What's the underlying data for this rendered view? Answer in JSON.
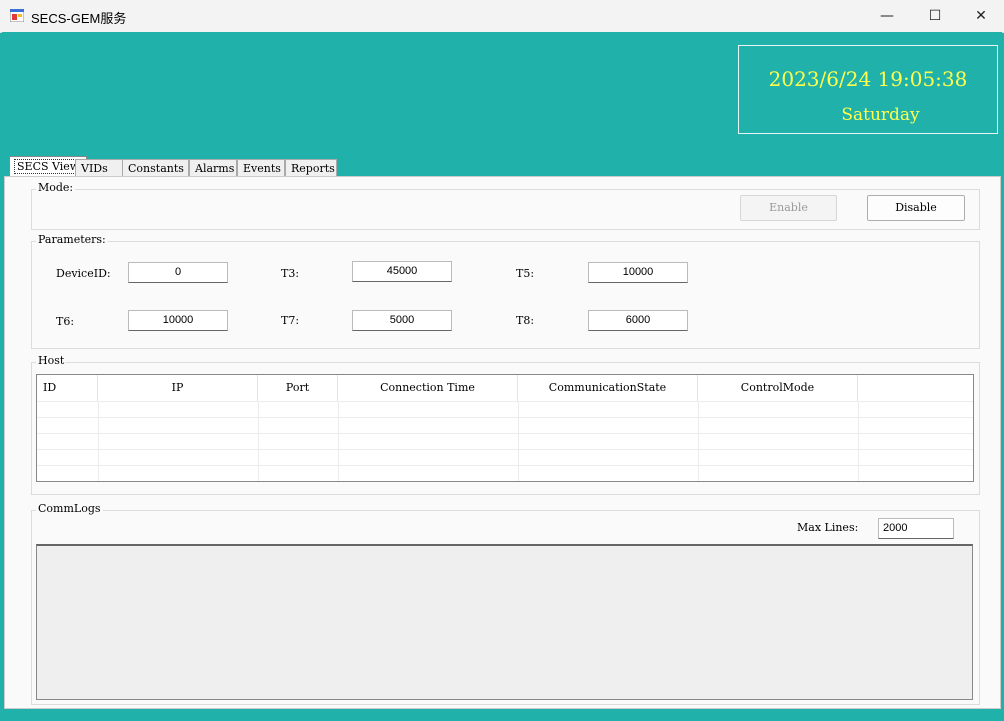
{
  "window": {
    "title": "SECS-GEM服务",
    "minimize": "—",
    "maximize": "☐",
    "close": "✕"
  },
  "clock": {
    "datetime": "2023/6/24 19:05:38",
    "weekday": "Saturday"
  },
  "tabs": [
    "SECS View",
    "VIDs",
    "Constants",
    "Alarms",
    "Events",
    "Reports"
  ],
  "mode": {
    "legend": "Mode:",
    "enable_label": "Enable",
    "disable_label": "Disable"
  },
  "parameters": {
    "legend": "Parameters:",
    "device_id": {
      "label": "DeviceID:",
      "value": "0"
    },
    "t3": {
      "label": "T3:",
      "value": "45000"
    },
    "t5": {
      "label": "T5:",
      "value": "10000"
    },
    "t6": {
      "label": "T6:",
      "value": "10000"
    },
    "t7": {
      "label": "T7:",
      "value": "5000"
    },
    "t8": {
      "label": "T8:",
      "value": "6000"
    }
  },
  "host": {
    "legend": "Host",
    "columns": [
      "ID",
      "IP",
      "Port",
      "Connection Time",
      "CommunicationState",
      "ControlMode"
    ]
  },
  "commlogs": {
    "legend": "CommLogs",
    "max_lines_label": "Max Lines:",
    "max_lines_value": "2000"
  },
  "colors": {
    "background": "#20b2aa",
    "clock_text": "#ffff4d"
  }
}
